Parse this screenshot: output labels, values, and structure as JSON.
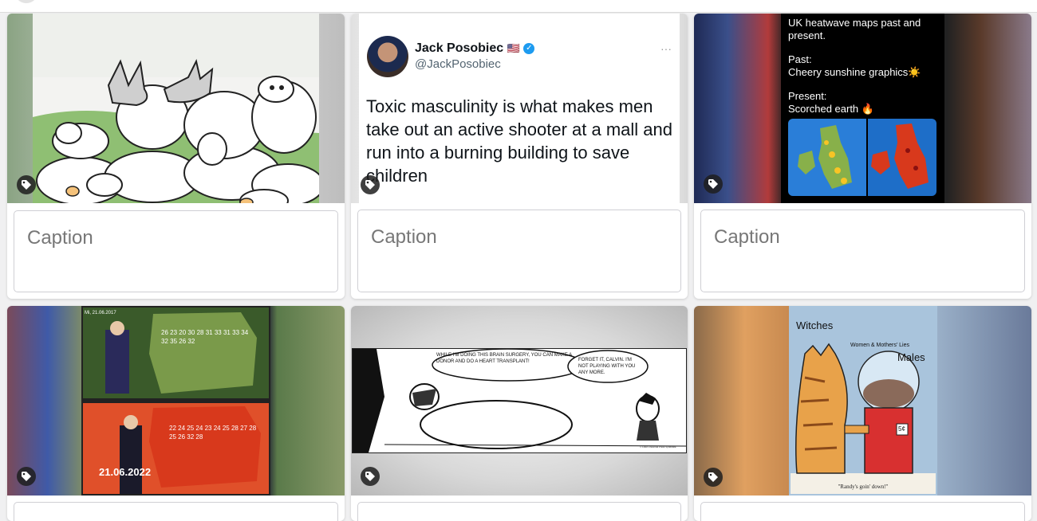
{
  "caption_placeholder": "Caption",
  "tweet": {
    "name": "Jack Posobiec",
    "flag": "🇺🇸",
    "handle": "@JackPosobiec",
    "more": "···",
    "text": "Toxic masculinity is what makes men take out an active shooter at a mall and run into a burning building to save children"
  },
  "heatwave": {
    "line1": "UK heatwave maps past and",
    "line2": "present.",
    "past_label": "Past:",
    "past_text": "Cheery sunshine graphics☀️",
    "present_label": "Present:",
    "present_text": "Scorched earth 🔥"
  },
  "weather_tv": {
    "date_top": "Mi, 21.06.2017",
    "date_bottom": "21.06.2022",
    "temps_top": [
      "26",
      "23",
      "20",
      "30",
      "28",
      "31",
      "33",
      "31",
      "33",
      "34",
      "32",
      "35",
      "26",
      "32"
    ],
    "temps_bottom": [
      "22",
      "24",
      "25",
      "24",
      "23",
      "24",
      "25",
      "28",
      "27",
      "28",
      "25",
      "26",
      "32",
      "28"
    ]
  },
  "calvin": {
    "bubble_left": "WHILE I'M DOING THIS BRAIN SURGERY, YOU CAN MAKE A DONOR AND DO A HEART TRANSPLANT!",
    "bubble_right": "FORGET IT, CALVIN. I'M NOT PLAYING WITH YOU ANY MORE.",
    "credit": "© 1990 Universal Press Syndicate"
  },
  "cartoon": {
    "label_witches": "Witches",
    "label_lies": "Women & Mothers' Lies",
    "label_males": "Males",
    "caption": "\"Randy's goin' down!\"",
    "price": "5¢"
  },
  "colors": {
    "card_bg": "#ffffff",
    "page_bg": "#f0f0f1",
    "verified": "#1d9bf0",
    "heat_red": "#d8391c"
  }
}
